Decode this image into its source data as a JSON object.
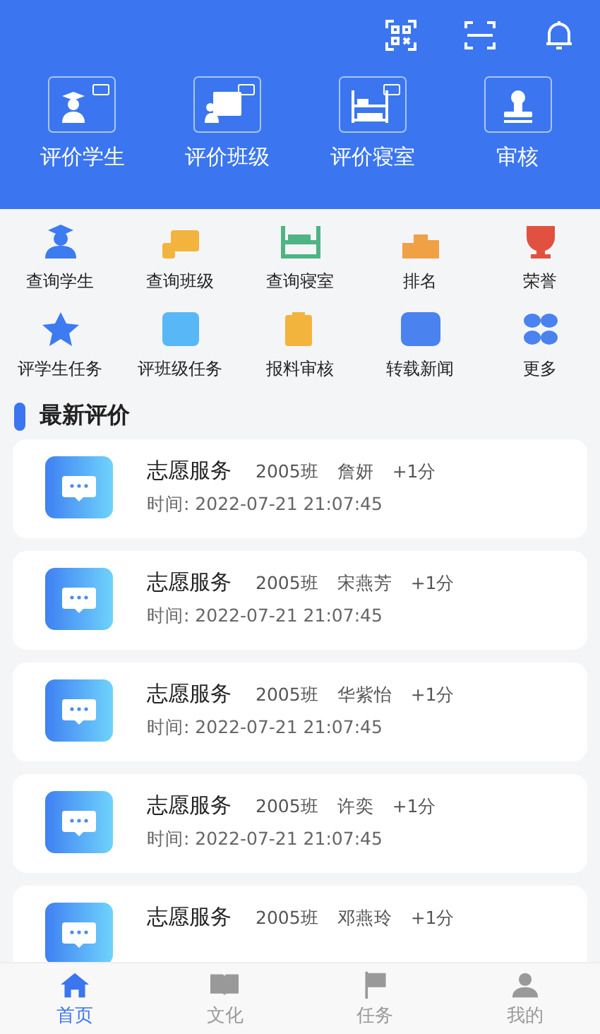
{
  "main_actions": [
    {
      "label": "评价学生"
    },
    {
      "label": "评价班级"
    },
    {
      "label": "评价寝室"
    },
    {
      "label": "审核"
    }
  ],
  "shortcuts": [
    {
      "label": "查询学生",
      "color": "#3d7bf0"
    },
    {
      "label": "查询班级",
      "color": "#f2b43c"
    },
    {
      "label": "查询寝室",
      "color": "#4fb484"
    },
    {
      "label": "排名",
      "color": "#f0a045"
    },
    {
      "label": "荣誉",
      "color": "#e0523f"
    },
    {
      "label": "评学生任务",
      "color": "#3d7bf0"
    },
    {
      "label": "评班级任务",
      "color": "#58b8f5"
    },
    {
      "label": "报料审核",
      "color": "#f2b43c"
    },
    {
      "label": "转载新闻",
      "color": "#4a82f0"
    },
    {
      "label": "更多",
      "color": "#4a82f0"
    }
  ],
  "section_title": "最新评价",
  "evaluations": [
    {
      "title": "志愿服务",
      "class": "2005班",
      "name": "詹妍",
      "score": "+1分",
      "time": "时间:  2022-07-21 21:07:45"
    },
    {
      "title": "志愿服务",
      "class": "2005班",
      "name": "宋燕芳",
      "score": "+1分",
      "time": "时间:  2022-07-21 21:07:45"
    },
    {
      "title": "志愿服务",
      "class": "2005班",
      "name": "华紫怡",
      "score": "+1分",
      "time": "时间:  2022-07-21 21:07:45"
    },
    {
      "title": "志愿服务",
      "class": "2005班",
      "name": "许奕",
      "score": "+1分",
      "time": "时间:  2022-07-21 21:07:45"
    },
    {
      "title": "志愿服务",
      "class": "2005班",
      "name": "邓燕玲",
      "score": "+1分"
    }
  ],
  "tab_bar": [
    {
      "label": "首页",
      "selected": true
    },
    {
      "label": "文化",
      "selected": false
    },
    {
      "label": "任务",
      "selected": false
    },
    {
      "label": "我的",
      "selected": false
    }
  ]
}
